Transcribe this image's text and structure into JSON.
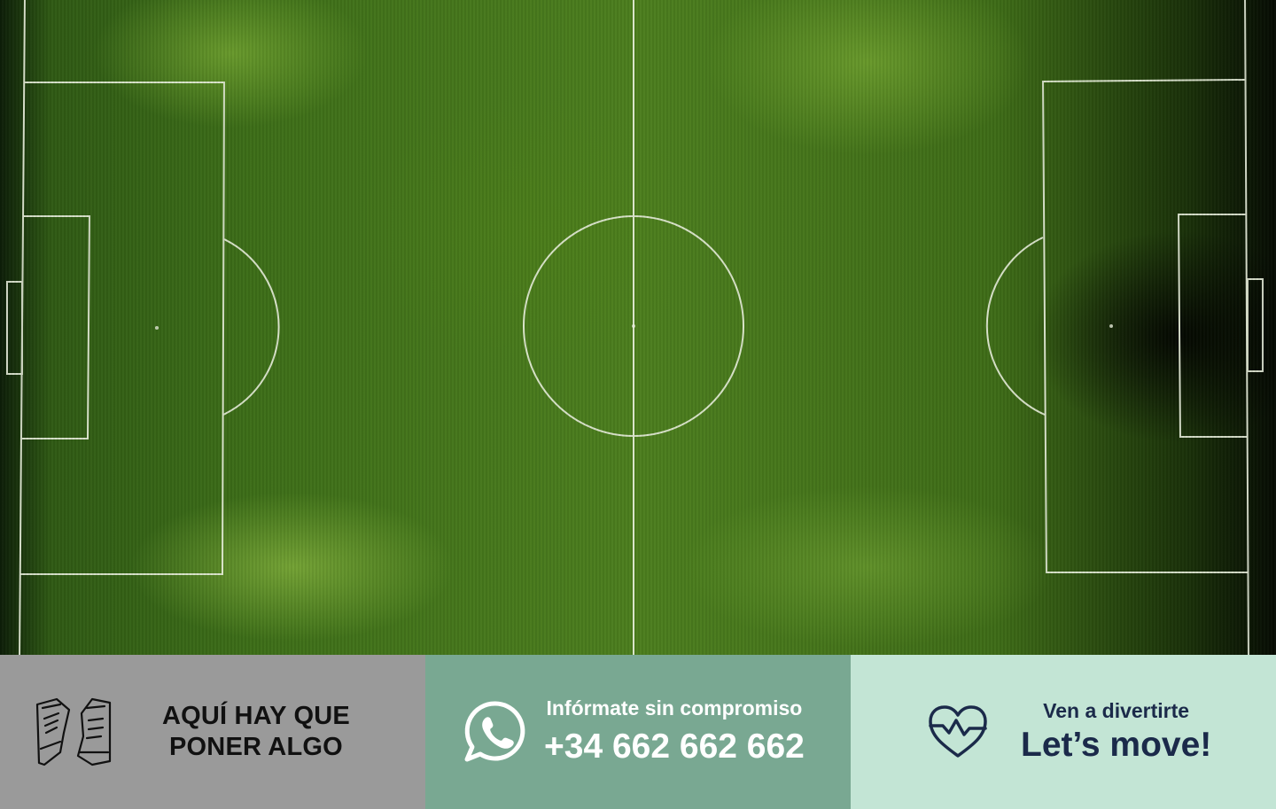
{
  "hero": {
    "image": "soccer-pitch-aerial-view"
  },
  "banner": {
    "panels": [
      {
        "icon": "sneakers-icon",
        "line1": "AQUÍ HAY QUE",
        "line2": "PONER ALGO",
        "background": "#9a9a9a",
        "text_color": "#111111"
      },
      {
        "icon": "whatsapp-icon",
        "subtitle": "Infórmate sin compromiso",
        "phone": "+34 662 662 662",
        "background": "#79a892",
        "text_color": "#ffffff"
      },
      {
        "icon": "heart-pulse-icon",
        "subtitle": "Ven a divertirte",
        "title": "Let’s move!",
        "background": "#c3e5d5",
        "text_color": "#1b2a4a"
      }
    ]
  }
}
